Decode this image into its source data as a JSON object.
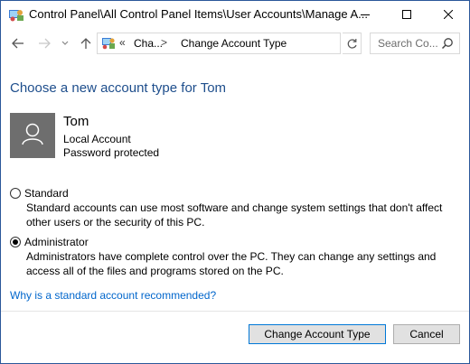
{
  "window": {
    "title": "Control Panel\\All Control Panel Items\\User Accounts\\Manage A..."
  },
  "nav": {
    "address_chevron": "«",
    "breadcrumb_1": "Cha...",
    "separator": ">",
    "breadcrumb_2": "Change Account Type",
    "search_placeholder": "Search Co..."
  },
  "main": {
    "heading": "Choose a new account type for Tom",
    "user": {
      "name": "Tom",
      "account_type": "Local Account",
      "password_status": "Password protected"
    },
    "options": [
      {
        "label": "Standard",
        "description_line1": "Standard accounts can use most software and change system settings that don't affect",
        "description_line2": "other users or the security of this PC.",
        "selected": false
      },
      {
        "label": "Administrator",
        "description_line1": "Administrators have complete control over the PC. They can change any settings and",
        "description_line2": "access all of the files and programs stored on the PC.",
        "selected": true
      }
    ],
    "help_link": "Why is a standard account recommended?"
  },
  "footer": {
    "change_button": "Change Account Type",
    "cancel_button": "Cancel"
  },
  "colors": {
    "heading": "#1e4e8c",
    "link": "#0066cc",
    "avatar_bg": "#6e6e6e",
    "window_border": "#2b579a"
  },
  "icons": [
    "control-panel-icon",
    "minimize-icon",
    "maximize-icon",
    "close-icon",
    "back-arrow-icon",
    "forward-arrow-icon",
    "history-dropdown-icon",
    "up-arrow-icon",
    "refresh-icon",
    "search-icon",
    "user-avatar-icon"
  ]
}
